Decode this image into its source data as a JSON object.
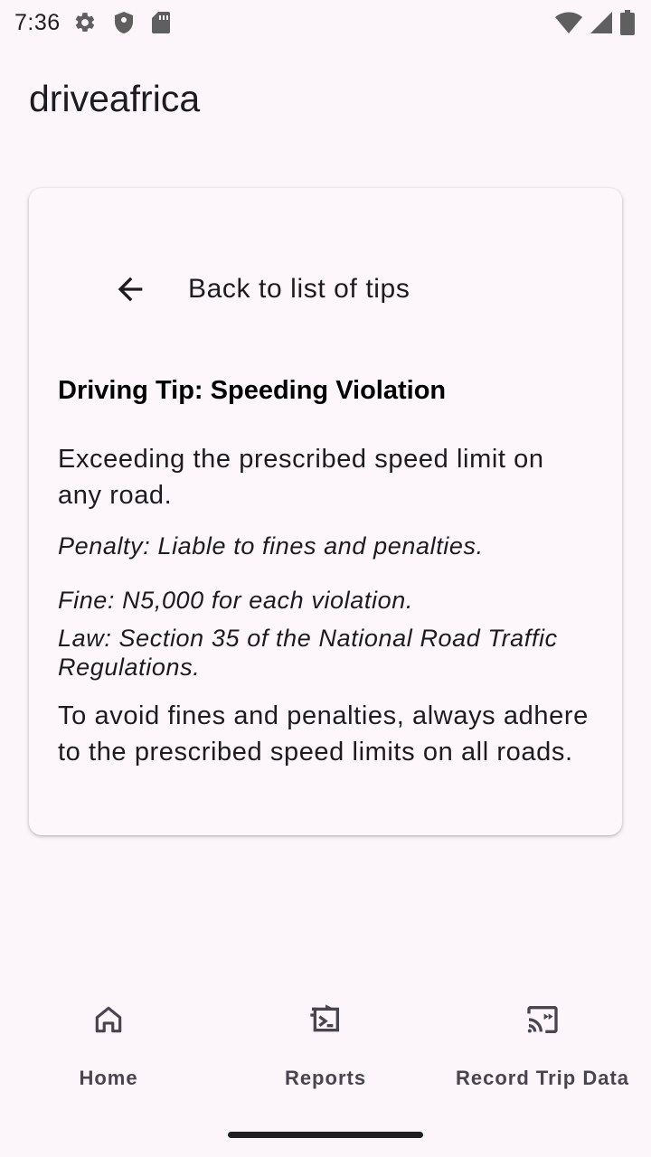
{
  "status_bar": {
    "time": "7:36",
    "icons_left": [
      "settings-icon",
      "shield-icon",
      "sim-card-icon"
    ],
    "icons_right": [
      "wifi-icon",
      "signal-icon",
      "battery-icon"
    ]
  },
  "app_bar": {
    "title": "driveafrica"
  },
  "card": {
    "back": {
      "icon": "arrow-back-icon",
      "label": "Back to list of tips"
    },
    "title": "Driving Tip: Speeding Violation",
    "description": "Exceeding the prescribed speed limit on any road.",
    "penalty": "Penalty: Liable to fines and penalties.",
    "fine": "Fine: N5,000 for each violation.",
    "law": "Law: Section 35 of the National Road Traffic Regulations.",
    "advice": "To avoid fines and penalties, always adhere to the prescribed speed limits on all roads."
  },
  "bottom_nav": {
    "items": [
      {
        "label": "Home",
        "icon": "home-icon"
      },
      {
        "label": "Reports",
        "icon": "reports-icon"
      },
      {
        "label": "Record Trip Data",
        "icon": "cast-icon"
      }
    ]
  },
  "colors": {
    "background": "#fcf6fa",
    "card": "#fdf7fb",
    "text": "#1c1b1f",
    "nav_text": "#49454f"
  }
}
